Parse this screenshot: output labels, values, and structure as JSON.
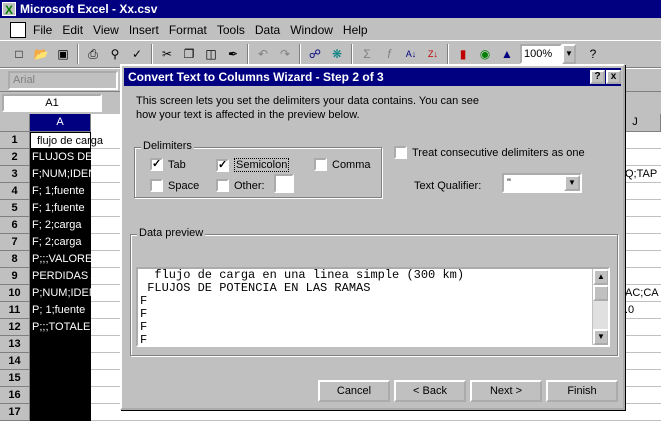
{
  "app": {
    "title": "Microsoft Excel - Xx.csv"
  },
  "menu": [
    "File",
    "Edit",
    "View",
    "Insert",
    "Format",
    "Tools",
    "Data",
    "Window",
    "Help"
  ],
  "toolbar": {
    "zoom": "100%",
    "font": "Arial"
  },
  "namebox": "A1",
  "grid": {
    "columns": [
      "A",
      "J"
    ],
    "rows": [
      {
        "num": "1",
        "a": "flujo de carga",
        "right": ""
      },
      {
        "num": "2",
        "a": "FLUJOS DE P",
        "right": ""
      },
      {
        "num": "3",
        "a": "F;NUM;IDENTIF",
        "right": "Q;TAP"
      },
      {
        "num": "4",
        "a": "F;   1;fuente",
        "right": ""
      },
      {
        "num": "5",
        "a": "F;   1;fuente",
        "right": ""
      },
      {
        "num": "6",
        "a": "F;   2;carga",
        "right": ""
      },
      {
        "num": "7",
        "a": "F;   2;carga",
        "right": ""
      },
      {
        "num": "8",
        "a": "P;;;VALORES T",
        "right": ""
      },
      {
        "num": "9",
        "a": "PERDIDAS AC",
        "right": ""
      },
      {
        "num": "10",
        "a": "P;NUM;IDENTIF",
        "right": "AC;CA"
      },
      {
        "num": "11",
        "a": "P;   1;fuente",
        "right": ".0"
      },
      {
        "num": "12",
        "a": "P;;;TOTALES;;",
        "right": ""
      },
      {
        "num": "13",
        "a": "",
        "right": ""
      },
      {
        "num": "14",
        "a": "",
        "right": ""
      },
      {
        "num": "15",
        "a": "",
        "right": ""
      },
      {
        "num": "16",
        "a": "",
        "right": ""
      },
      {
        "num": "17",
        "a": "",
        "right": ""
      }
    ]
  },
  "dialog": {
    "title": "Convert Text to Columns Wizard - Step 2 of 3",
    "help_btn": "?",
    "close_btn": "x",
    "description": "This screen lets you set the delimiters your data contains.  You can see how your text is affected in the preview below.",
    "delimiters_label": "Delimiters",
    "tab": {
      "label": "Tab",
      "checked": true
    },
    "semicolon": {
      "label": "Semicolon",
      "checked": true
    },
    "comma": {
      "label": "Comma",
      "checked": false
    },
    "space": {
      "label": "Space",
      "checked": false
    },
    "other": {
      "label": "Other:",
      "checked": false
    },
    "consecutive": {
      "label": "Treat consecutive delimiters as one",
      "checked": false
    },
    "qualifier_label": "Text Qualifier:",
    "qualifier_value": "\"",
    "preview_label": "Data preview",
    "preview_lines": [
      "  flujo de carga en una linea simple (300 km)",
      " FLUJOS DE POTENCIA EN LAS RAMAS",
      "F",
      "F",
      "F",
      "F"
    ],
    "buttons": {
      "cancel": "Cancel",
      "back": "< Back",
      "next": "Next >",
      "finish": "Finish"
    }
  }
}
